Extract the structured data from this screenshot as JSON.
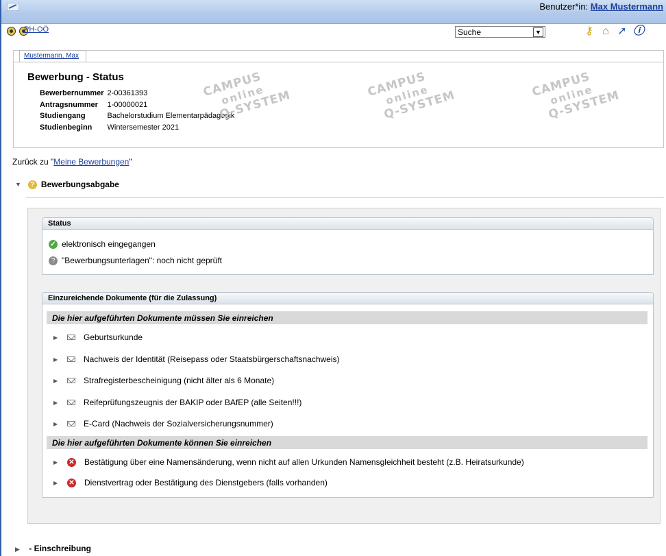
{
  "header": {
    "user_label": "Benutzer*in:",
    "user_name": "Max Mustermann",
    "institution": "PH-OÖ",
    "search_value": "Suche"
  },
  "tab": {
    "label": "Mustermann, Max"
  },
  "info": {
    "title": "Bewerbung - Status",
    "rows": [
      {
        "key": "Bewerbernummer",
        "value": "2-00361393"
      },
      {
        "key": "Antragsnummer",
        "value": "1-00000021"
      },
      {
        "key": "Studiengang",
        "value": "Bachelorstudium Elementarpädagogik"
      },
      {
        "key": "Studienbeginn",
        "value": "Wintersemester 2021"
      }
    ]
  },
  "watermark": {
    "line1": "CAMPUS",
    "line2": "online",
    "line3": "Q-SYSTEM"
  },
  "back": {
    "prefix": "Zurück zu \"",
    "link": "Meine Bewerbungen",
    "suffix": "\""
  },
  "section": {
    "title": "Bewerbungsabgabe"
  },
  "status": {
    "header": "Status",
    "items": [
      "elektronisch eingegangen",
      "\"Bewerbungsunterlagen\": noch nicht geprüft"
    ]
  },
  "documents": {
    "header": "Einzureichende Dokumente (für die Zulassung)",
    "required_heading": "Die hier aufgeführten Dokumente müssen Sie einreichen",
    "required": [
      "Geburtsurkunde",
      "Nachweis der Identität (Reisepass oder Staatsbürgerschaftsnachweis)",
      "Strafregisterbescheinigung (nicht älter als 6 Monate)",
      "Reifeprüfungszeugnis der BAKIP oder BAfEP (alle Seiten!!!)",
      "E-Card (Nachweis der Sozialversicherungsnummer)"
    ],
    "optional_heading": "Die hier aufgeführten Dokumente können Sie einreichen",
    "optional": [
      "Bestätigung über eine Namensänderung, wenn nicht auf allen Urkunden Namensgleichheit besteht (z.B. Heiratsurkunde)",
      "Dienstvertrag oder Bestätigung des Dienstgebers (falls vorhanden)"
    ]
  },
  "bottom_section": {
    "title": "- Einschreibung"
  },
  "colors": {
    "link": "#1a3f9c",
    "ok": "#52a843",
    "warn": "#e2b93c",
    "error": "#cc2a2a"
  }
}
